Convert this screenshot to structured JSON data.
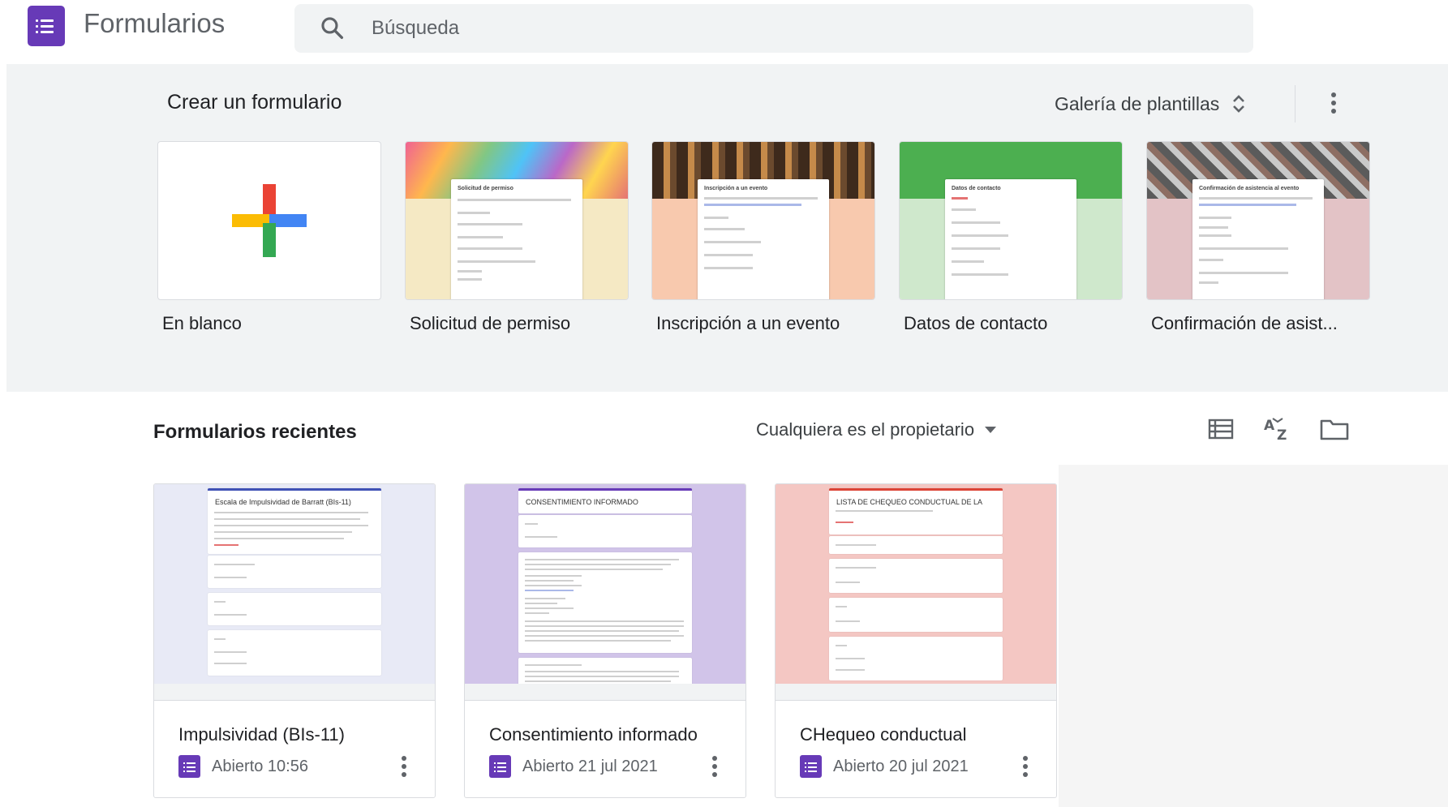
{
  "app": {
    "title": "Formularios",
    "logo_icon": "forms-logo-icon",
    "accent": "#673ab7"
  },
  "search": {
    "placeholder": "Búsqueda",
    "value": ""
  },
  "gallery": {
    "title": "Crear un formulario",
    "switch_label": "Galería de plantillas",
    "templates": [
      {
        "label": "En blanco",
        "thumb_title": ""
      },
      {
        "label": "Solicitud de permiso",
        "thumb_title": "Solicitud de permiso"
      },
      {
        "label": "Inscripción a un evento",
        "thumb_title": "Inscripción a un evento"
      },
      {
        "label": "Datos de contacto",
        "thumb_title": "Datos de contacto"
      },
      {
        "label": "Confirmación de asist...",
        "thumb_title": "Confirmación de asistencia al evento"
      }
    ]
  },
  "recent": {
    "title": "Formularios recientes",
    "owner_filter": "Cualquiera es el propietario",
    "forms": [
      {
        "name": "Impulsividad (BIs-11)",
        "opened": "Abierto 10:56",
        "thumb_title": "Escala de Impulsividad de Barratt (BIs-11)",
        "color": "#e8eaf6"
      },
      {
        "name": "Consentimiento informado",
        "opened": "Abierto 21 jul 2021",
        "thumb_title": "CONSENTIMIENTO INFORMADO",
        "color": "#d1c4e9"
      },
      {
        "name": "CHequeo conductual",
        "opened": "Abierto 20 jul 2021",
        "thumb_title": "LISTA DE CHEQUEO CONDUCTUAL DE LA",
        "color": "#f4c7c3"
      }
    ]
  }
}
